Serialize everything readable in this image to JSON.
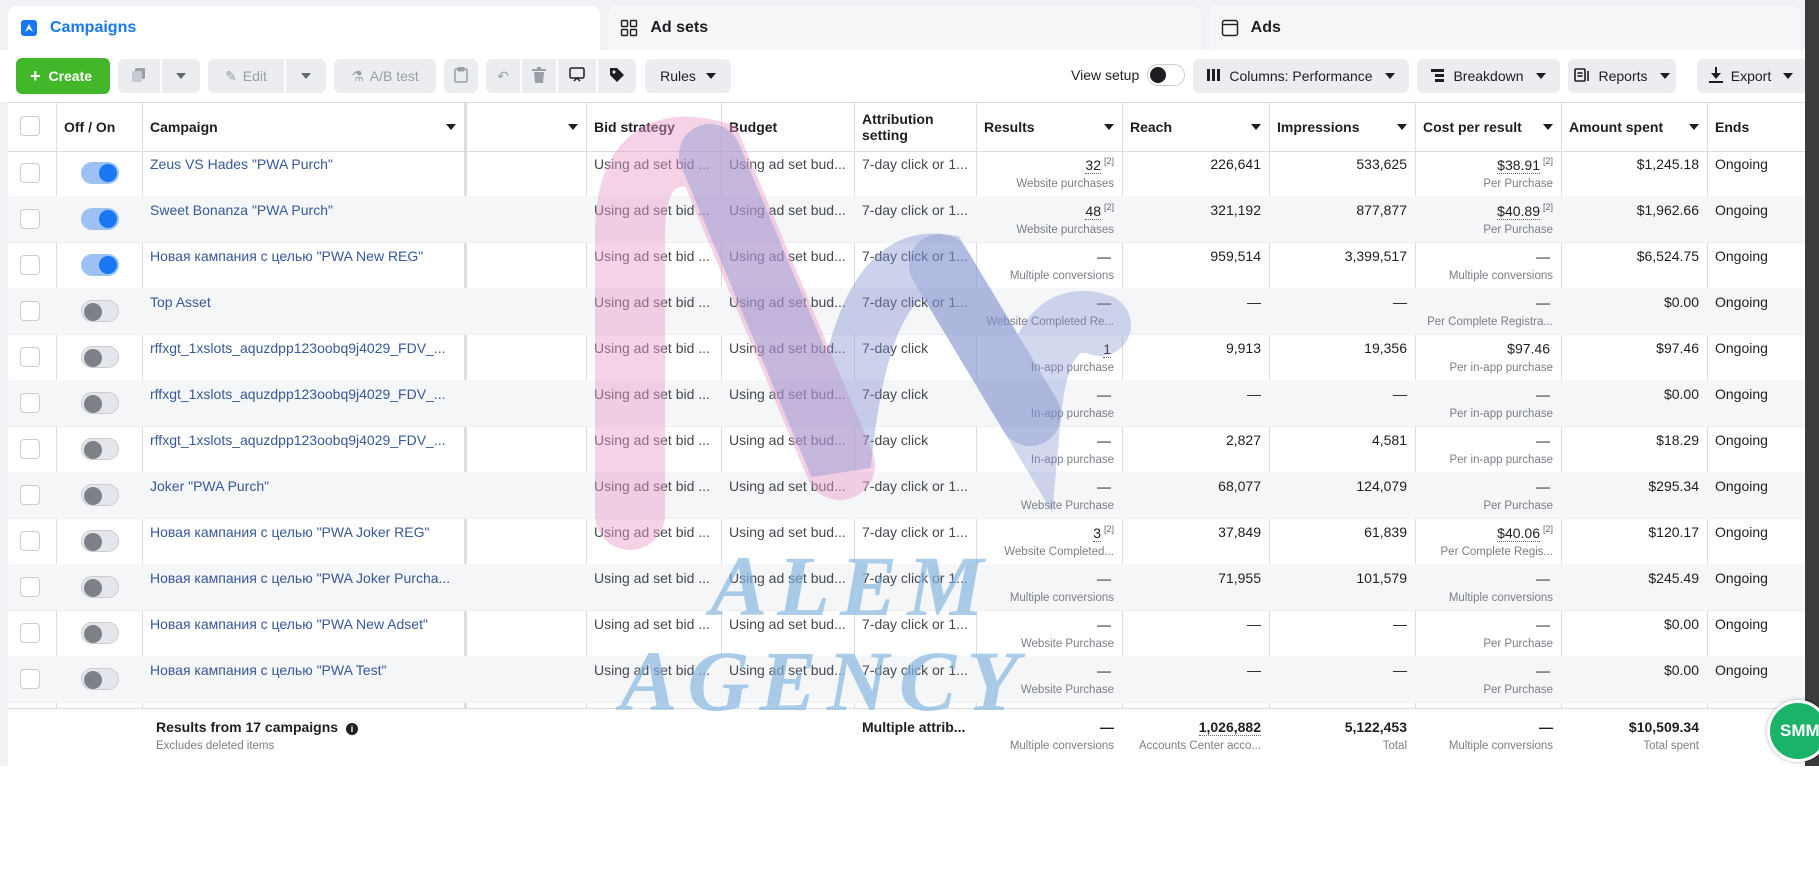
{
  "tabs": [
    {
      "label": "Campaigns",
      "icon": "flag-icon"
    },
    {
      "label": "Ad sets",
      "icon": "grid-icon"
    },
    {
      "label": "Ads",
      "icon": "window-icon"
    }
  ],
  "toolbar": {
    "create_label": "Create",
    "edit_label": "Edit",
    "ab_test_label": "A/B test",
    "rules_label": "Rules",
    "view_setup_label": "View setup",
    "columns_label": "Columns: Performance",
    "breakdown_label": "Breakdown",
    "reports_label": "Reports",
    "export_label": "Export"
  },
  "columns": {
    "off_on": "Off / On",
    "campaign": "Campaign",
    "blank": "",
    "bid_strategy": "Bid strategy",
    "budget": "Budget",
    "attribution_line1": "Attribution",
    "attribution_line2": "setting",
    "results": "Results",
    "reach": "Reach",
    "impressions": "Impressions",
    "cost_per_result": "Cost per result",
    "amount_spent": "Amount spent",
    "ends": "Ends"
  },
  "rows": [
    {
      "on": true,
      "campaign": "Zeus VS Hades \"PWA Purch\"",
      "bid": "Using ad set bid ...",
      "budget": "Using ad set bud...",
      "attribution": "7-day click or 1...",
      "results": "32",
      "results_fn": "[2]",
      "results_sub": "Website purchases",
      "reach": "226,641",
      "impressions": "533,625",
      "cpr": "$38.91",
      "cpr_fn": "[2]",
      "cpr_sub": "Per Purchase",
      "spent": "$1,245.18",
      "ends": "Ongoing"
    },
    {
      "on": true,
      "campaign": "Sweet Bonanza \"PWA Purch\"",
      "bid": "Using ad set bid ...",
      "budget": "Using ad set bud...",
      "attribution": "7-day click or 1...",
      "results": "48",
      "results_fn": "[2]",
      "results_sub": "Website purchases",
      "reach": "321,192",
      "impressions": "877,877",
      "cpr": "$40.89",
      "cpr_fn": "[2]",
      "cpr_sub": "Per Purchase",
      "spent": "$1,962.66",
      "ends": "Ongoing"
    },
    {
      "on": true,
      "campaign": "Новая кампания с целью \"PWA New REG\"",
      "bid": "Using ad set bid ...",
      "budget": "Using ad set bud...",
      "attribution": "7-day click or 1...",
      "results": "—",
      "results_fn": "",
      "results_sub": "Multiple conversions",
      "reach": "959,514",
      "impressions": "3,399,517",
      "cpr": "—",
      "cpr_fn": "",
      "cpr_sub": "Multiple conversions",
      "spent": "$6,524.75",
      "ends": "Ongoing"
    },
    {
      "on": false,
      "campaign": "Top Asset",
      "bid": "Using ad set bid ...",
      "budget": "Using ad set bud...",
      "attribution": "7-day click or 1...",
      "results": "—",
      "results_fn": "",
      "results_sub": "Website Completed Re...",
      "reach": "—",
      "impressions": "—",
      "cpr": "—",
      "cpr_fn": "",
      "cpr_sub": "Per Complete Registra...",
      "spent": "$0.00",
      "ends": "Ongoing"
    },
    {
      "on": false,
      "campaign": "rffxgt_1xslots_aquzdpp123oobq9j4029_FDV_...",
      "bid": "Using ad set bid ...",
      "budget": "Using ad set bud...",
      "attribution": "7-day click",
      "results": "1",
      "results_fn": "",
      "results_sub": "In-app purchase",
      "reach": "9,913",
      "impressions": "19,356",
      "cpr": "$97.46",
      "cpr_fn": "",
      "cpr_sub": "Per in-app purchase",
      "spent": "$97.46",
      "ends": "Ongoing"
    },
    {
      "on": false,
      "campaign": "rffxgt_1xslots_aquzdpp123oobq9j4029_FDV_...",
      "bid": "Using ad set bid ...",
      "budget": "Using ad set bud...",
      "attribution": "7-day click",
      "results": "—",
      "results_fn": "",
      "results_sub": "In-app purchase",
      "reach": "—",
      "impressions": "—",
      "cpr": "—",
      "cpr_fn": "",
      "cpr_sub": "Per in-app purchase",
      "spent": "$0.00",
      "ends": "Ongoing"
    },
    {
      "on": false,
      "campaign": "rffxgt_1xslots_aquzdpp123oobq9j4029_FDV_...",
      "bid": "Using ad set bid ...",
      "budget": "Using ad set bud...",
      "attribution": "7-day click",
      "results": "—",
      "results_fn": "",
      "results_sub": "In-app purchase",
      "reach": "2,827",
      "impressions": "4,581",
      "cpr": "—",
      "cpr_fn": "",
      "cpr_sub": "Per in-app purchase",
      "spent": "$18.29",
      "ends": "Ongoing"
    },
    {
      "on": false,
      "campaign": "Joker \"PWA Purch\"",
      "bid": "Using ad set bid ...",
      "budget": "Using ad set bud...",
      "attribution": "7-day click or 1...",
      "results": "—",
      "results_fn": "",
      "results_sub": "Website Purchase",
      "reach": "68,077",
      "impressions": "124,079",
      "cpr": "—",
      "cpr_fn": "",
      "cpr_sub": "Per Purchase",
      "spent": "$295.34",
      "ends": "Ongoing"
    },
    {
      "on": false,
      "campaign": "Новая кампания с целью \"PWA Joker REG\"",
      "bid": "Using ad set bid ...",
      "budget": "Using ad set bud...",
      "attribution": "7-day click or 1...",
      "results": "3",
      "results_fn": "[2]",
      "results_sub": "Website Completed...",
      "reach": "37,849",
      "impressions": "61,839",
      "cpr": "$40.06",
      "cpr_fn": "[2]",
      "cpr_sub": "Per Complete Regis...",
      "spent": "$120.17",
      "ends": "Ongoing"
    },
    {
      "on": false,
      "campaign": "Новая кампания с целью \"PWA Joker Purcha...",
      "bid": "Using ad set bid ...",
      "budget": "Using ad set bud...",
      "attribution": "7-day click or 1...",
      "results": "—",
      "results_fn": "",
      "results_sub": "Multiple conversions",
      "reach": "71,955",
      "impressions": "101,579",
      "cpr": "—",
      "cpr_fn": "",
      "cpr_sub": "Multiple conversions",
      "spent": "$245.49",
      "ends": "Ongoing"
    },
    {
      "on": false,
      "campaign": "Новая кампания с целью \"PWA New Adset\"",
      "bid": "Using ad set bid ...",
      "budget": "Using ad set bud...",
      "attribution": "7-day click or 1...",
      "results": "—",
      "results_fn": "",
      "results_sub": "Website Purchase",
      "reach": "—",
      "impressions": "—",
      "cpr": "—",
      "cpr_fn": "",
      "cpr_sub": "Per Purchase",
      "spent": "$0.00",
      "ends": "Ongoing"
    },
    {
      "on": false,
      "campaign": "Новая кампания с целью \"PWA Test\"",
      "bid": "Using ad set bid ...",
      "budget": "Using ad set bud...",
      "attribution": "7-day click or 1...",
      "results": "—",
      "results_fn": "",
      "results_sub": "Website Purchase",
      "reach": "—",
      "impressions": "—",
      "cpr": "—",
      "cpr_fn": "",
      "cpr_sub": "Per Purchase",
      "spent": "$0.00",
      "ends": "Ongoing"
    }
  ],
  "totals": {
    "label": "Results from 17 campaigns",
    "sub": "Excludes deleted items",
    "attribution": "Multiple attrib...",
    "results": "—",
    "results_sub": "Multiple conversions",
    "reach": "1,026,882",
    "reach_sub": "Accounts Center acco...",
    "impressions": "5,122,453",
    "impressions_sub": "Total",
    "cpr": "—",
    "cpr_sub": "Multiple conversions",
    "spent": "$10,509.34",
    "spent_sub": "Total spent"
  },
  "watermark": {
    "line1": "ALEM",
    "line2": "AGENCY"
  },
  "chat_widget": {
    "label": "SMM"
  },
  "colors": {
    "accent": "#1877f2",
    "create": "#42b72a",
    "link": "#385898",
    "watermark_pink": "#e89cc8",
    "watermark_blue": "#7fb3e0"
  }
}
